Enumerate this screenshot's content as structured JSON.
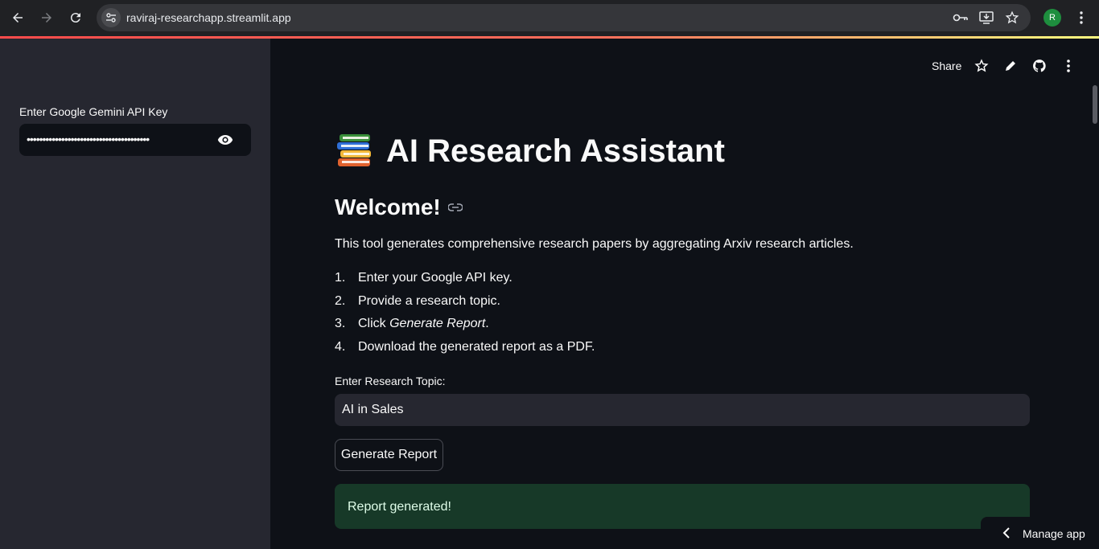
{
  "browser": {
    "url": "raviraj-researchapp.streamlit.app",
    "profile_initial": "R"
  },
  "sidebar": {
    "api_key_label": "Enter Google Gemini API Key",
    "api_key_value": "•••••••••••••••••••••••••••••••••••••••"
  },
  "toolbar": {
    "share_label": "Share"
  },
  "main": {
    "title": "AI Research Assistant",
    "welcome": "Welcome!",
    "intro": "This tool generates comprehensive research papers by aggregating Arxiv research articles.",
    "steps": [
      {
        "num": "1.",
        "text": "Enter your Google API key."
      },
      {
        "num": "2.",
        "text": "Provide a research topic."
      },
      {
        "num": "3.",
        "pre": "Click ",
        "em": "Generate Report",
        "post": "."
      },
      {
        "num": "4.",
        "text": "Download the generated report as a PDF."
      }
    ],
    "topic_label": "Enter Research Topic:",
    "topic_value": "AI in Sales",
    "generate_button": "Generate Report",
    "success_message": "Report generated!"
  },
  "manage_app": {
    "label": "Manage app"
  },
  "colors": {
    "background": "#0e1117",
    "sidebar": "#262730",
    "success_bg": "#173928",
    "accent": "#ff4b4b"
  }
}
